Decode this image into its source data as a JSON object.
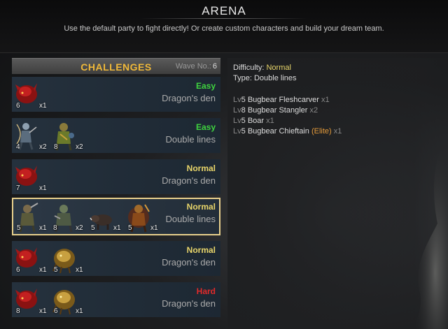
{
  "header": {
    "title": "ARENA",
    "subtitle": "Use the default party to fight directly! Or create custom characters and build your dream team."
  },
  "challenges": {
    "title": "CHALLENGES",
    "wave_label": "Wave No.:",
    "wave_number": "6",
    "rows": [
      {
        "difficulty": "Easy",
        "mode": "Dragon's den",
        "units": [
          {
            "level": "6",
            "count": "x1"
          }
        ]
      },
      {
        "difficulty": "Easy",
        "mode": "Double lines",
        "units": [
          {
            "level": "4",
            "count": "x2"
          },
          {
            "level": "8",
            "count": "x2"
          }
        ]
      },
      {
        "difficulty": "Normal",
        "mode": "Dragon's den",
        "units": [
          {
            "level": "7",
            "count": "x1"
          }
        ]
      },
      {
        "difficulty": "Normal",
        "mode": "Double lines",
        "units": [
          {
            "level": "5",
            "count": "x1"
          },
          {
            "level": "8",
            "count": "x2"
          },
          {
            "level": "5",
            "count": "x1"
          },
          {
            "level": "5",
            "count": "x1"
          }
        ]
      },
      {
        "difficulty": "Normal",
        "mode": "Dragon's den",
        "units": [
          {
            "level": "6",
            "count": "x1"
          },
          {
            "level": "5",
            "count": "x1"
          }
        ]
      },
      {
        "difficulty": "Hard",
        "mode": "Dragon's den",
        "units": [
          {
            "level": "8",
            "count": "x1"
          },
          {
            "level": "6",
            "count": "x1"
          }
        ]
      }
    ]
  },
  "details": {
    "difficulty_label": "Difficulty:",
    "difficulty_value": "Normal",
    "type_label": "Type:",
    "type_value": "Double lines",
    "enemies": [
      {
        "lv": "Lv",
        "level": "5",
        "name": "Bugbear Fleshcarver",
        "count": "x1"
      },
      {
        "lv": "Lv",
        "level": "8",
        "name": "Bugbear Stangler",
        "count": "x2"
      },
      {
        "lv": "Lv",
        "level": "5",
        "name": "Boar",
        "count": "x1"
      },
      {
        "lv": "Lv",
        "level": "5",
        "name": "Bugbear Chieftain",
        "elite": "(Elite)",
        "count": "x1"
      }
    ]
  },
  "colors": {
    "easy": "#3fd43f",
    "normal": "#e8d56a",
    "hard": "#e02a2a",
    "accent": "#f0b93a",
    "selected_border": "#e8d08c"
  },
  "icons": {
    "red_dragon": "red-dragon-portrait-icon",
    "golden_dragon": "golden-dragon-portrait-icon",
    "bugbear": "bugbear-portrait-icon",
    "archer": "archer-portrait-icon",
    "boar": "boar-portrait-icon",
    "chieftain": "chieftain-portrait-icon"
  }
}
